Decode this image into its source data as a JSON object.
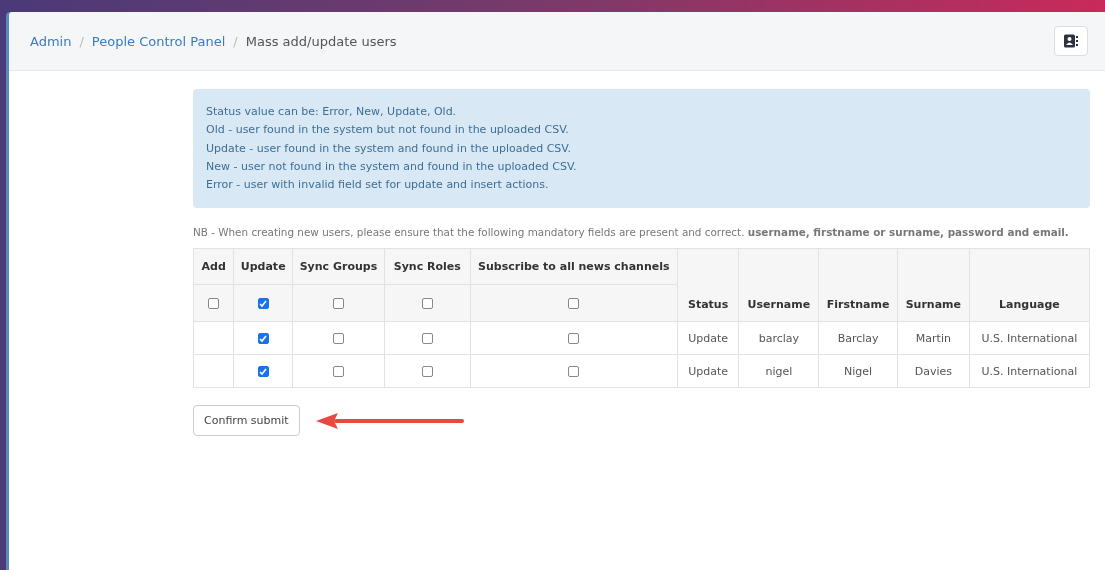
{
  "breadcrumb_separator": "/",
  "breadcrumbs": [
    {
      "label": "Admin",
      "current": false
    },
    {
      "label": "People Control Panel",
      "current": false
    },
    {
      "label": "Mass add/update users",
      "current": true
    }
  ],
  "info_lines": [
    "Status value can be: Error, New, Update, Old.",
    "Old - user found in the system but not found in the uploaded CSV.",
    "Update - user found in the system and found in the uploaded CSV.",
    "New - user not found in the system and found in the uploaded CSV.",
    "Error - user with invalid field set for update and insert actions."
  ],
  "note": "NB - When creating new users, please ensure that the following mandatory fields are present and correct. **username, firstname or surname, password and email.**",
  "table": {
    "check_columns": [
      {
        "label": "Add",
        "all_checked": false
      },
      {
        "label": "Update",
        "all_checked": true
      },
      {
        "label": "Sync Groups",
        "all_checked": false
      },
      {
        "label": "Sync Roles",
        "all_checked": false
      },
      {
        "label": "Subscribe to all news channels",
        "all_checked": false
      }
    ],
    "text_columns": [
      "Status",
      "Username",
      "Firstname",
      "Surname",
      "Language"
    ],
    "rows": [
      {
        "checks": [
          {
            "kind": "blank"
          },
          {
            "kind": "checkbox",
            "checked": true
          },
          {
            "kind": "checkbox",
            "checked": false
          },
          {
            "kind": "checkbox",
            "checked": false
          },
          {
            "kind": "checkbox",
            "checked": false
          }
        ],
        "texts": [
          "Update",
          "barclay",
          "Barclay",
          "Martin",
          "U.S. International"
        ]
      },
      {
        "checks": [
          {
            "kind": "blank"
          },
          {
            "kind": "checkbox",
            "checked": true
          },
          {
            "kind": "checkbox",
            "checked": false
          },
          {
            "kind": "checkbox",
            "checked": false
          },
          {
            "kind": "checkbox",
            "checked": false
          }
        ],
        "texts": [
          "Update",
          "nigel",
          "Nigel",
          "Davies",
          "U.S. International"
        ]
      }
    ]
  },
  "submit_button": "Confirm submit"
}
